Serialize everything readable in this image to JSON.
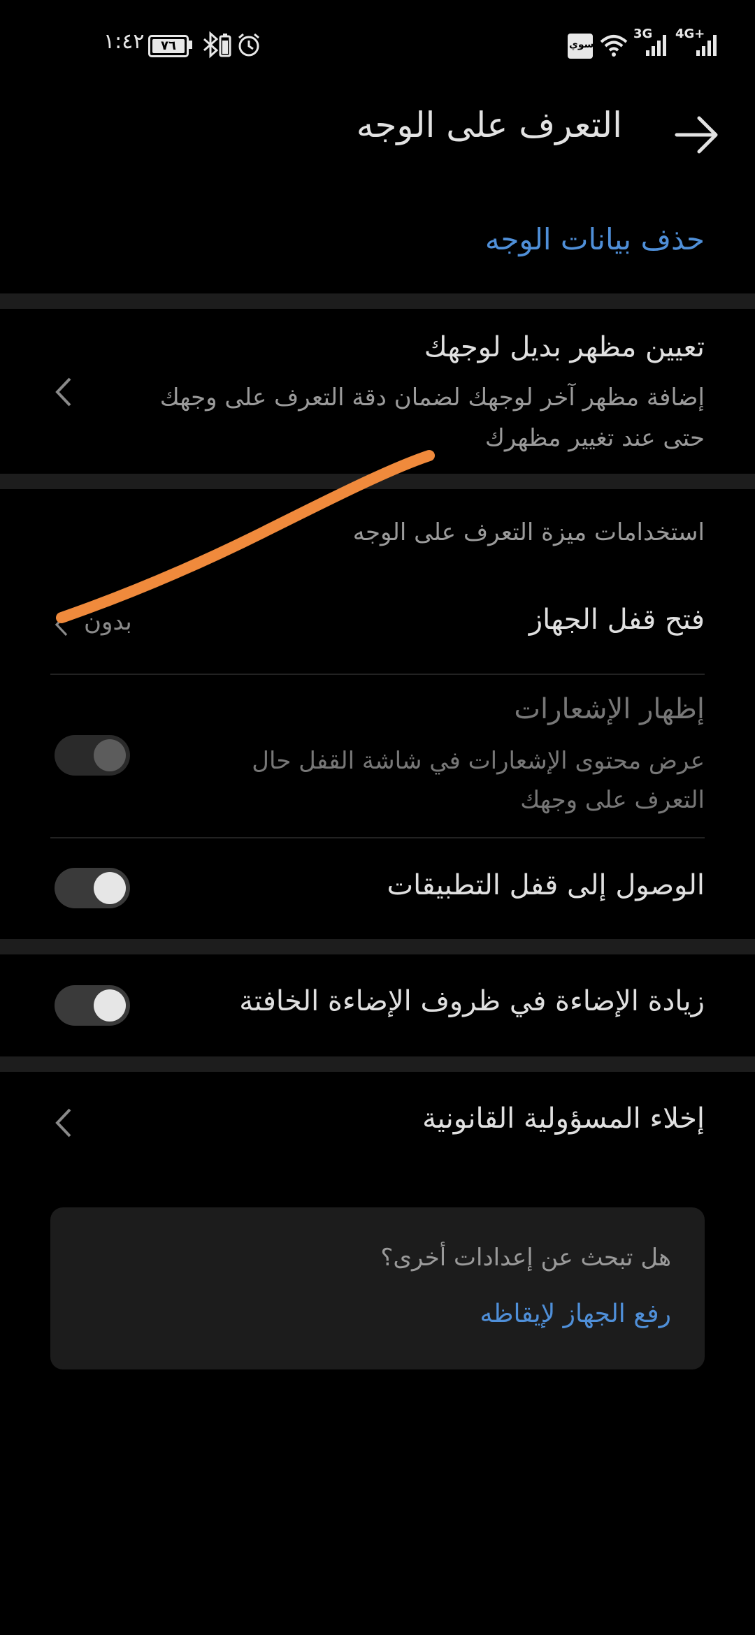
{
  "status_bar": {
    "time": "١:٤٢",
    "battery": "٧٦",
    "carrier_label": "سوي",
    "net1": "3G",
    "net2": "4G+"
  },
  "header": {
    "title": "التعرف على الوجه",
    "back_icon": "arrow-right-icon"
  },
  "actions": {
    "delete_face_data": "حذف بيانات الوجه"
  },
  "alternate_appearance": {
    "title": "تعيين مظهر بديل لوجهك",
    "subtitle_line1": "إضافة مظهر آخر لوجهك لضمان دقة التعرف على وجهك",
    "subtitle_line2": "حتى عند تغيير مظهرك"
  },
  "uses_section": {
    "header": "استخدامات ميزة التعرف على الوجه",
    "unlock_device": {
      "label": "فتح قفل الجهاز",
      "value": "بدون"
    },
    "show_notifications": {
      "label": "إظهار الإشعارات",
      "subtitle_line1": "عرض محتوى الإشعارات في شاشة القفل حال",
      "subtitle_line2": "التعرف على وجهك",
      "enabled": false,
      "checked": true
    },
    "app_lock_access": {
      "label": "الوصول إلى قفل التطبيقات",
      "checked": true
    }
  },
  "low_light": {
    "label": "زيادة الإضاءة في ظروف الإضاءة الخافتة",
    "checked": true
  },
  "legal": {
    "label": "إخلاء المسؤولية القانونية"
  },
  "more_settings_card": {
    "question": "هل تبحث عن إعدادات أخرى؟",
    "link": "رفع الجهاز لإيقاظه"
  },
  "colors": {
    "accent_blue": "#4f8fd8",
    "scribble_orange": "#f08a3c",
    "background": "#000000"
  }
}
